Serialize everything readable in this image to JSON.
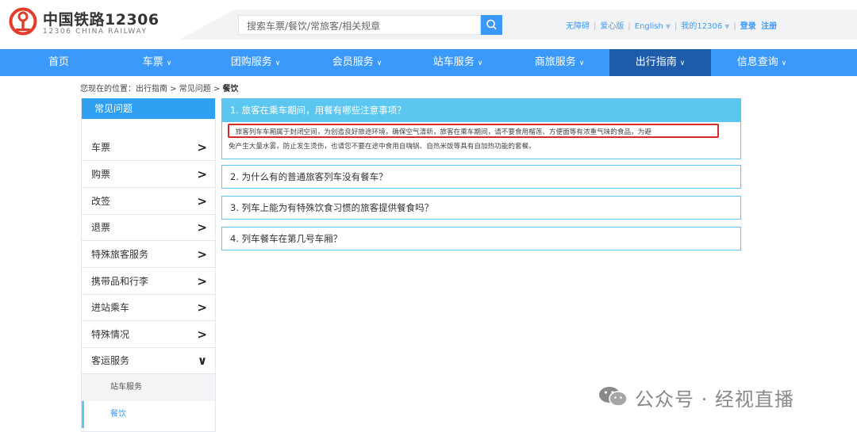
{
  "brand": {
    "name_cn": "中国铁路12306",
    "name_en": "12306 CHINA RAILWAY",
    "logo_color": "#e23c2c"
  },
  "search": {
    "placeholder": "搜索车票/餐饮/常旅客/相关规章",
    "button_icon": "search-icon"
  },
  "toplinks": {
    "accessible": "无障碍",
    "caring": "爱心版",
    "language": "English",
    "my12306": "我的12306",
    "login": "登录",
    "register": "注册"
  },
  "nav": {
    "items": [
      {
        "label": "首页",
        "has_menu": false
      },
      {
        "label": "车票",
        "has_menu": true
      },
      {
        "label": "团购服务",
        "has_menu": true
      },
      {
        "label": "会员服务",
        "has_menu": true
      },
      {
        "label": "站车服务",
        "has_menu": true
      },
      {
        "label": "商旅服务",
        "has_menu": true
      },
      {
        "label": "出行指南",
        "has_menu": true,
        "active": true
      },
      {
        "label": "信息查询",
        "has_menu": true
      }
    ],
    "bg_color": "#3b99fc",
    "active_color": "#1e5cab"
  },
  "breadcrumb": {
    "prefix": "您现在的位置：出行指南 > 常见问题 > ",
    "current": "餐饮"
  },
  "sidebar": {
    "title": "常见问题",
    "items": [
      {
        "label": "车票"
      },
      {
        "label": "购票"
      },
      {
        "label": "改签"
      },
      {
        "label": "退票"
      },
      {
        "label": "特殊旅客服务"
      },
      {
        "label": "携带品和行李"
      },
      {
        "label": "进站乘车"
      },
      {
        "label": "特殊情况"
      },
      {
        "label": "客运服务",
        "expanded": true
      }
    ],
    "sub_items": [
      {
        "label": "站车服务",
        "active": false
      },
      {
        "label": "餐饮",
        "active": true
      }
    ]
  },
  "faq": [
    {
      "question": "1. 旅客在乘车期间，用餐有哪些注意事项？",
      "expanded": true,
      "answer_line1": "　旅客列车车厢属于封闭空间，为创造良好旅途环境，确保空气清新，旅客在乘车期间，请不要食用榴莲、方便面等有浓重气味的食品，为避",
      "answer_line2": "免产生大量水雾，防止发生烫伤，也请您不要在途中食用自嗨锅、自热米饭等具有自加热功能的套餐。"
    },
    {
      "question": "2. 为什么有的普通旅客列车没有餐车？",
      "expanded": false
    },
    {
      "question": "3. 列车上能为有特殊饮食习惯的旅客提供餐食吗？",
      "expanded": false
    },
    {
      "question": "4. 列车餐车在第几号车厢？",
      "expanded": false
    }
  ],
  "watermark": {
    "text": "公众号 · 经视直播",
    "icon": "wechat-icon"
  }
}
